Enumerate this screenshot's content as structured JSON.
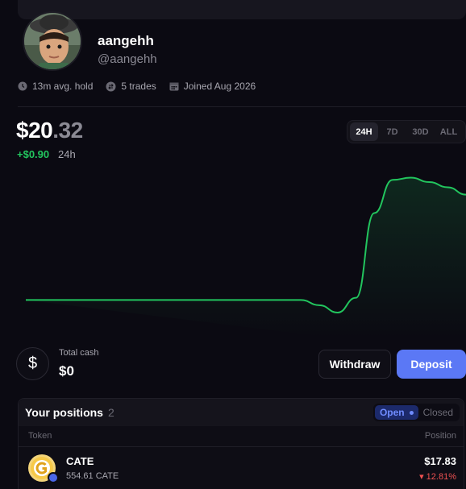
{
  "profile": {
    "username": "aangehh",
    "handle": "@aangehh"
  },
  "stats": {
    "avg_hold": "13m avg. hold",
    "trades": "5 trades",
    "joined": "Joined Aug 2026"
  },
  "balance": {
    "whole": "$20",
    "cents": ".32",
    "change": "+$0.90",
    "period": "24h"
  },
  "range_tabs": [
    "24H",
    "7D",
    "30D",
    "ALL"
  ],
  "range_selected": "24H",
  "chart_data": {
    "type": "line",
    "title": "",
    "xlabel": "",
    "ylabel": "",
    "series": [
      {
        "color": "#22c55e",
        "values": [
          19.42,
          19.42,
          19.42,
          19.42,
          19.42,
          19.42,
          19.42,
          19.42,
          19.42,
          19.42,
          19.42,
          19.42,
          19.42,
          19.42,
          19.42,
          19.42,
          19.35,
          19.25,
          19.45,
          20.6,
          21.05,
          21.08,
          21.02,
          20.95,
          20.85
        ]
      }
    ],
    "grid": false
  },
  "cash": {
    "label": "Total cash",
    "value": "$0",
    "symbol": "$"
  },
  "actions": {
    "withdraw": "Withdraw",
    "deposit": "Deposit"
  },
  "positions": {
    "title": "Your positions",
    "count": "2",
    "toggle_open": "Open",
    "toggle_closed": "Closed",
    "col_token": "Token",
    "col_position": "Position",
    "rows": [
      {
        "name": "CATE",
        "amount": "554.61 CATE",
        "value": "$17.83",
        "change": "▾ 12.81%"
      }
    ]
  },
  "colors": {
    "accent": "#5b78f5",
    "positive": "#22c55e",
    "negative": "#f05252",
    "background": "#0b0a12"
  }
}
